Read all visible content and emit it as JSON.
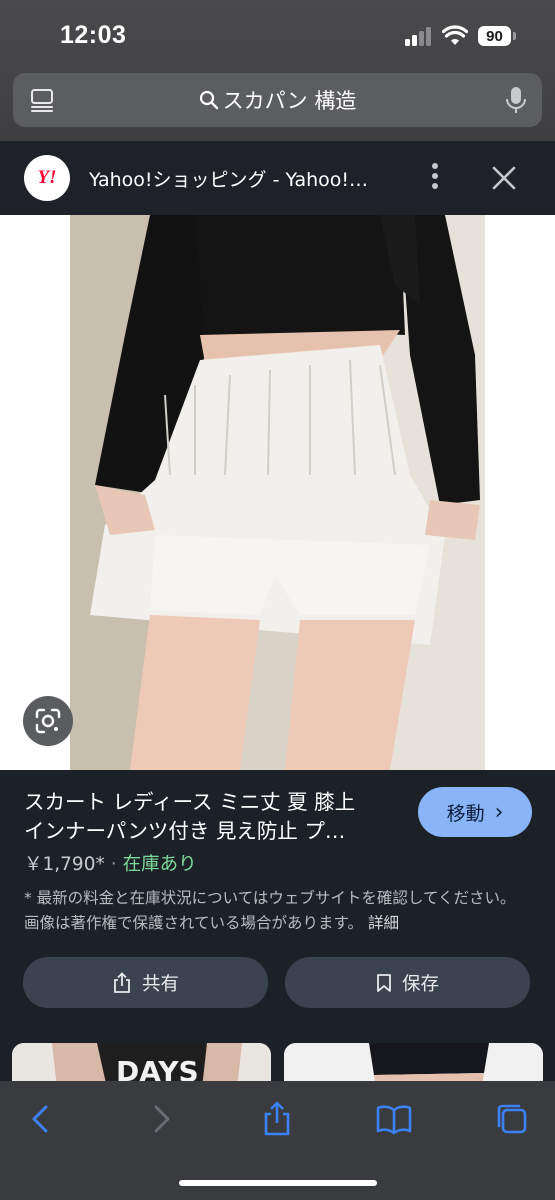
{
  "status_bar": {
    "time": "12:03",
    "battery": "90"
  },
  "search": {
    "query": "スカパン 構造"
  },
  "source": {
    "logo_text": "Y!",
    "title": "Yahoo!ショッピング - Yahoo!…"
  },
  "product": {
    "title_line1": "スカート レディース ミニ丈 夏 膝上",
    "title_line2": "インナーパンツ付き 見え防止 プ…",
    "go_label": "移動",
    "price": "￥1,790*",
    "separator": "·",
    "stock": "在庫あり",
    "disclaimer": "* 最新の料金と在庫状況についてはウェブサイトを確認してください。 画像は著作権で保護されている場合があります。",
    "details_link": "詳細"
  },
  "actions": {
    "share_label": "共有",
    "save_label": "保存"
  },
  "related": [
    {
      "text": "DAYS"
    },
    {
      "text": ""
    }
  ],
  "colors": {
    "accent_button": "#8ab4f8",
    "in_stock": "#7dd99a",
    "toolbar_icon": "#3b82f6",
    "background": "#1c2027"
  },
  "icons": {
    "menu": "tab-menu-icon",
    "search": "search-icon",
    "mic": "mic-icon",
    "lens": "google-lens-icon",
    "share": "share-icon",
    "save": "bookmark-icon",
    "back": "back-chevron-icon",
    "forward": "forward-chevron-icon",
    "toolbar_share": "share-icon",
    "bookmarks": "book-icon",
    "tabs": "tabs-icon"
  }
}
